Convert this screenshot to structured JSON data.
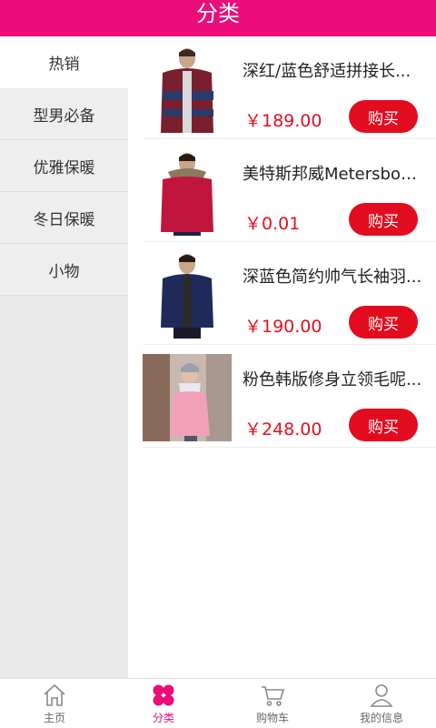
{
  "header": {
    "title": "分类"
  },
  "sidebar": {
    "items": [
      {
        "label": "热销",
        "active": true
      },
      {
        "label": "型男必备",
        "active": false
      },
      {
        "label": "优雅保暖",
        "active": false
      },
      {
        "label": "冬日保暖",
        "active": false
      },
      {
        "label": "小物",
        "active": false
      }
    ]
  },
  "products": [
    {
      "name": "深红/蓝色舒适拼接长...",
      "price": "￥189.00",
      "buy_label": "购买"
    },
    {
      "name": "美特斯邦威Metersbon...",
      "price": "￥0.01",
      "buy_label": "购买"
    },
    {
      "name": "深蓝色简约帅气长袖羽...",
      "price": "￥190.00",
      "buy_label": "购买"
    },
    {
      "name": "粉色韩版修身立领毛呢...",
      "price": "￥248.00",
      "buy_label": "购买"
    }
  ],
  "tabbar": {
    "items": [
      {
        "label": "主页",
        "icon": "home-icon",
        "active": false
      },
      {
        "label": "分类",
        "icon": "category-icon",
        "active": true
      },
      {
        "label": "购物车",
        "icon": "cart-icon",
        "active": false
      },
      {
        "label": "我的信息",
        "icon": "user-icon",
        "active": false
      }
    ]
  },
  "colors": {
    "brand": "#ec0d78",
    "price": "#e3101e",
    "buy_button": "#e30c1f"
  }
}
